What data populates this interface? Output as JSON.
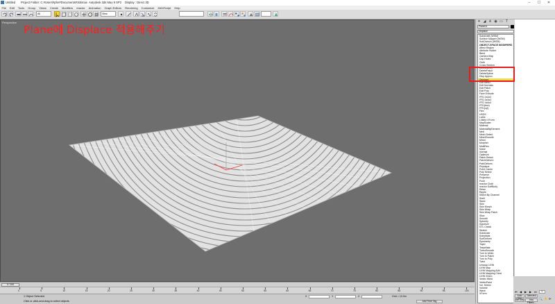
{
  "titlebar": {
    "untitled": "Untitled",
    "project": "Project Folder: C:#Users#pfer#Documents#3dsmax",
    "app": "Autodesk 3ds Max 9 SP2",
    "display": "Display : Direct 3D",
    "minimize": "–",
    "maximize": "☐",
    "close": "✕"
  },
  "menu": [
    "File",
    "Edit",
    "Tools",
    "Group",
    "Views",
    "Create",
    "Modifiers",
    "reactor",
    "Animation",
    "Graph Editors",
    "Rendering",
    "Customize",
    "MAXScript",
    "Help"
  ],
  "toolbar": {
    "selection_filter": "All",
    "view_dropdown": "View"
  },
  "viewport": {
    "label": "Perspective",
    "annotation": "Plane에 Displace 적용해주기"
  },
  "command_panel": {
    "object_name": "Plane01",
    "modifier_dropdown": "Displace",
    "modifiers": [
      "Subdivide (WSM)",
      "Surface Mapper (WSM)",
      "SubDivison (WSM)",
      "OBJECT-SPACE MODIFIERS",
      "Affect Region",
      "Attribute Holder",
      "Bend",
      "Camera Map",
      "Cap Holes",
      "Cloth",
      "Cross Section",
      "DeleteMesh",
      "DeletePatch",
      "DeleteSpline",
      "Disp Approx",
      "Displace",
      "Edit Mesh",
      "Edit Normals",
      "Edit Patch",
      "Edit Poly",
      "Face Extrude",
      "FFD 2x2x2",
      "FFD 3x3x3",
      "FFD 4x4x4",
      "FFD(box)",
      "FFD(cyl)",
      "Flex",
      "HSDS",
      "Lathe",
      "Linked XForm",
      "MapScaler",
      "Material",
      "MaterialByElement",
      "Melt",
      "Mesh Select",
      "MeshSmooth",
      "Mirror",
      "Morpher",
      "MultiRes",
      "Noise",
      "Normal",
      "Optimize",
      "Patch Select",
      "PatchDeform",
      "PathDeform",
      "Physique",
      "Point Cache",
      "Poly Select",
      "Preserve",
      "Projection",
      "Push",
      "reactor Cloth",
      "reactor SoftBody",
      "Relax",
      "Ripple",
      "Select By Channel",
      "Shell",
      "Skew",
      "Skin",
      "Skin Morph",
      "Skin Wrap",
      "Skin Wrap Patch",
      "Slice",
      "Smooth",
      "Spherify",
      "Squeeze",
      "STL Check",
      "Stretch",
      "Subdivide",
      "Substitute",
      "SurfDeform",
      "Symmetry",
      "Taper",
      "Tessellate",
      "TurboSmooth",
      "Turn to Mesh",
      "Turn to Patch",
      "Turn to Poly",
      "Twist",
      "Unwrap UVW",
      "UVW Map",
      "UVW Mapping Add",
      "UVW Mapping Clear",
      "UVW Xform",
      "Vertex Weld",
      "VertexPaint",
      "Vol. Select",
      "Volume",
      "Wave",
      "XForm"
    ],
    "selected_index": 15,
    "header_index": 3
  },
  "timeline": {
    "slider": "0 / 100",
    "ticks": [
      "0",
      "5",
      "10",
      "15",
      "20",
      "25",
      "30",
      "35",
      "40",
      "45",
      "50",
      "55",
      "60",
      "65",
      "70",
      "75",
      "80",
      "85",
      "90",
      "95",
      "100"
    ]
  },
  "status": {
    "selected": "1 Object Selected",
    "prompt": "Click or click-and-drag to select objects",
    "x": "X",
    "y": "Y",
    "z": "Z",
    "grid": "Grid = 10.0m",
    "add_time_tag": "Add Time Tag"
  },
  "animation": {
    "auto_key": "Auto Key",
    "set_key": "Set Key",
    "selected": "Selected",
    "key_filters": "Key Filters...",
    "frame": "0"
  },
  "colors": {
    "annotation": "#ff1f1f",
    "highlight": "#e81a1a",
    "viewport_bg": "#6e6e6e",
    "selected_modifier": "#f0e050"
  }
}
